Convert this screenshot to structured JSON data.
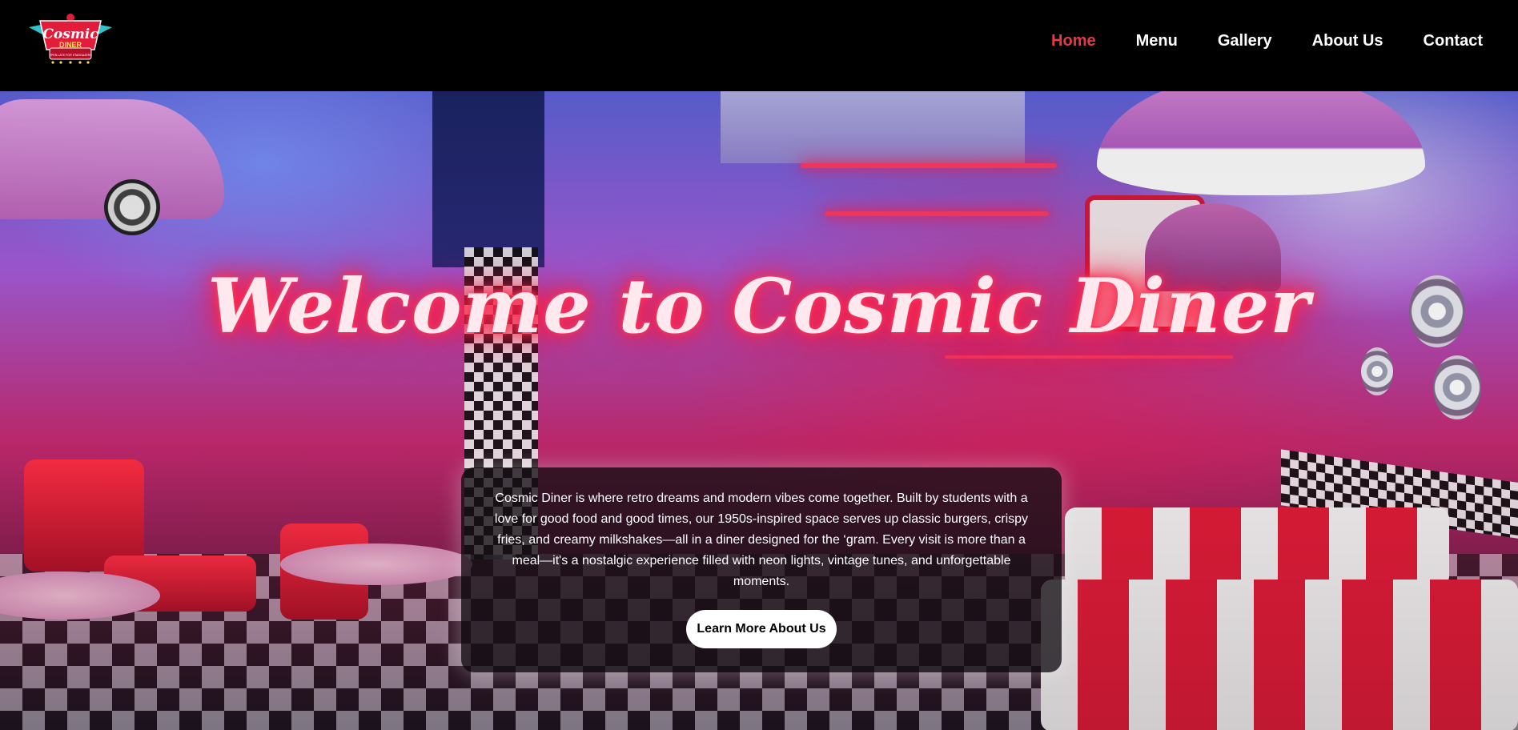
{
  "header": {
    "logo": {
      "line1": "Cosmic",
      "line2": "DINER",
      "tagline": "OPEN LATE FOR STARGAZERS"
    },
    "nav": [
      {
        "label": "Home",
        "active": true
      },
      {
        "label": "Menu",
        "active": false
      },
      {
        "label": "Gallery",
        "active": false
      },
      {
        "label": "About Us",
        "active": false
      },
      {
        "label": "Contact",
        "active": false
      }
    ]
  },
  "hero": {
    "title": "Welcome to Cosmic Diner",
    "intro": "Cosmic Diner is where retro dreams and modern vibes come together. Built by students with a love for good food and good times, our 1950s-inspired space serves up classic burgers, crispy fries, and creamy milkshakes—all in a diner designed for the ‘gram. Every visit is more than a meal—it's a nostalgic experience filled with neon lights, vintage tunes, and unforgettable moments.",
    "cta_label": "Learn More About Us"
  },
  "colors": {
    "header_bg": "#000000",
    "nav_active": "#e63946",
    "nav_text": "#ffffff",
    "title_glow": "#ff2a4d",
    "logo_red": "#e21c39",
    "logo_teal": "#2ec4c9"
  }
}
